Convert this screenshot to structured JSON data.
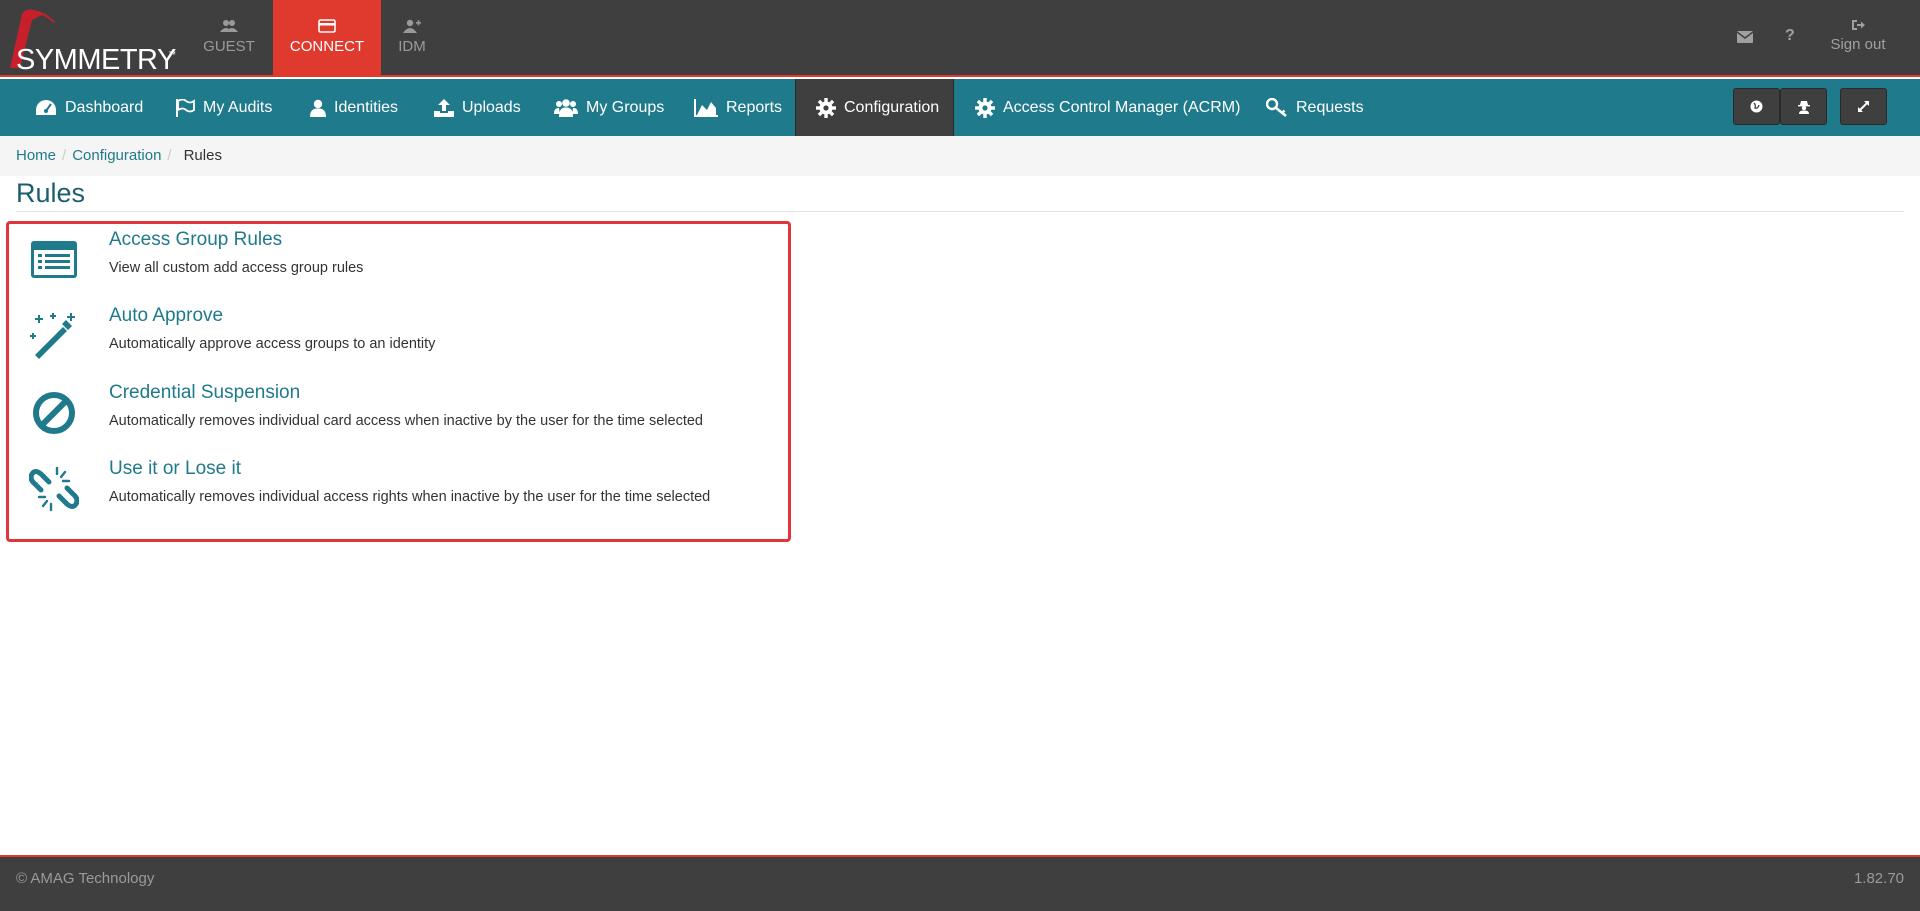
{
  "brand": {
    "name": "SYMMETRY",
    "tm": "™"
  },
  "app_tabs": [
    {
      "label": "GUEST",
      "icon": "users-icon",
      "active": false
    },
    {
      "label": "CONNECT",
      "icon": "card-icon",
      "active": true
    },
    {
      "label": "IDM",
      "icon": "user-plus-icon",
      "active": false
    }
  ],
  "top_right": {
    "signout_label": "Sign out"
  },
  "nav": {
    "items": [
      {
        "label": "Dashboard",
        "icon": "dashboard-icon"
      },
      {
        "label": "My Audits",
        "icon": "flag-icon"
      },
      {
        "label": "Identities",
        "icon": "user-icon"
      },
      {
        "label": "Uploads",
        "icon": "upload-icon"
      },
      {
        "label": "My Groups",
        "icon": "group-icon"
      },
      {
        "label": "Reports",
        "icon": "area-chart-icon"
      },
      {
        "label": "Configuration",
        "icon": "gear-icon",
        "active": true
      },
      {
        "label": "Access Control Manager (ACRM)",
        "icon": "gear-icon"
      },
      {
        "label": "Requests",
        "icon": "key-icon"
      }
    ]
  },
  "breadcrumb": {
    "home": "Home",
    "configuration": "Configuration",
    "current": "Rules"
  },
  "page": {
    "title": "Rules"
  },
  "rules": [
    {
      "title": "Access Group Rules",
      "desc": "View all custom add access group rules",
      "icon": "list-icon"
    },
    {
      "title": "Auto Approve",
      "desc": "Automatically approve access groups to an identity",
      "icon": "magic-wand-icon"
    },
    {
      "title": "Credential Suspension",
      "desc": "Automatically removes individual card access when inactive by the user for the time selected",
      "icon": "ban-icon"
    },
    {
      "title": "Use it or Lose it",
      "desc": "Automatically removes individual access rights when inactive by the user for the time selected",
      "icon": "broken-link-icon"
    }
  ],
  "footer": {
    "copyright": "© AMAG Technology",
    "version": "1.82.70"
  },
  "colors": {
    "accent": "#1f7a8c",
    "brand_red": "#e03a2f",
    "dark_bar": "#3f3f3f",
    "highlight_border": "#e0353a"
  }
}
